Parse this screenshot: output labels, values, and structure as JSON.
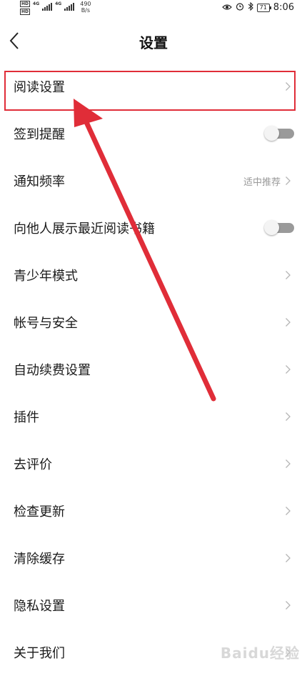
{
  "status_bar": {
    "hd1": "HD",
    "hd2": "HD",
    "net1": "4G",
    "net2": "4G",
    "speed_value": "490",
    "speed_unit": "B/s",
    "battery": "71",
    "time": "8:06"
  },
  "header": {
    "title": "设置"
  },
  "settings": [
    {
      "label": "阅读设置",
      "kind": "chevron"
    },
    {
      "label": "签到提醒",
      "kind": "toggle",
      "on": false
    },
    {
      "label": "通知频率",
      "kind": "value",
      "value": "适中推荐"
    },
    {
      "label": "向他人展示最近阅读书籍",
      "kind": "toggle",
      "on": false
    },
    {
      "label": "青少年模式",
      "kind": "chevron"
    },
    {
      "label": "帐号与安全",
      "kind": "chevron"
    },
    {
      "label": "自动续费设置",
      "kind": "chevron"
    },
    {
      "label": "插件",
      "kind": "chevron"
    },
    {
      "label": "去评价",
      "kind": "chevron"
    },
    {
      "label": "检查更新",
      "kind": "chevron"
    },
    {
      "label": "清除缓存",
      "kind": "chevron"
    },
    {
      "label": "隐私设置",
      "kind": "chevron"
    },
    {
      "label": "关于我们",
      "kind": "chevron"
    }
  ],
  "annotation": {
    "color": "#e02d38"
  },
  "watermark": "Baidu经验"
}
